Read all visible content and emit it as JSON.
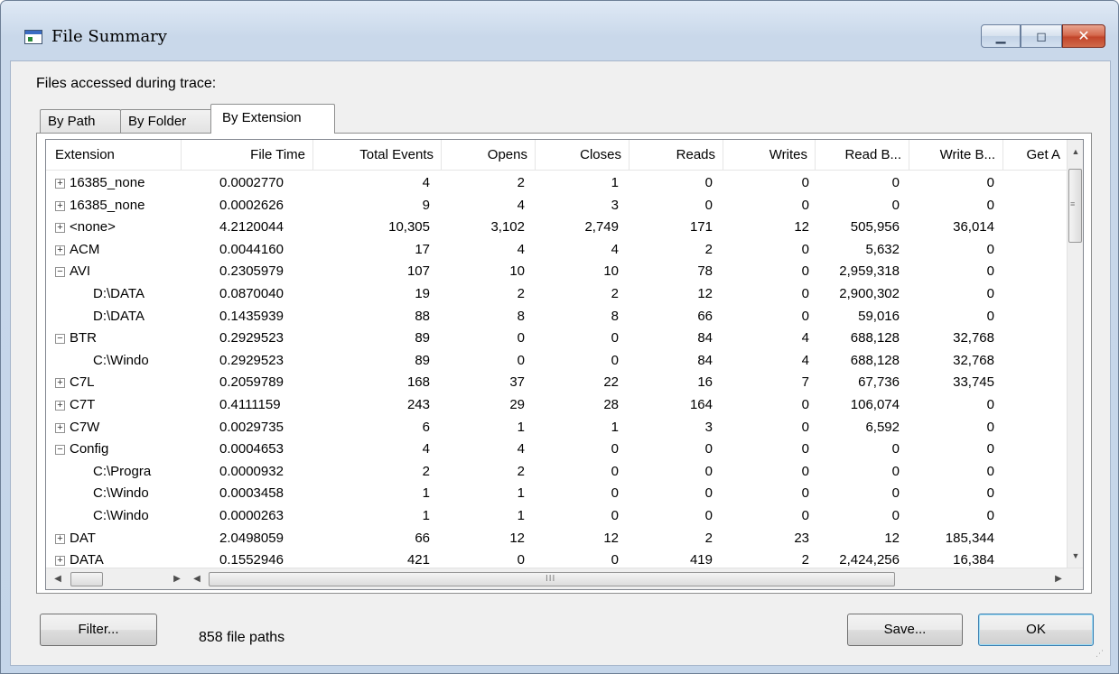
{
  "window": {
    "title": "File Summary",
    "caption_buttons": [
      {
        "name": "minimize",
        "glyph": "▁"
      },
      {
        "name": "maximize",
        "glyph": "◻"
      },
      {
        "name": "close",
        "glyph": "✕"
      }
    ]
  },
  "label_accessed": "Files accessed during trace:",
  "tabs": [
    {
      "label": "By Path",
      "active": false
    },
    {
      "label": "By Folder",
      "active": false
    },
    {
      "label": "By Extension",
      "active": true
    }
  ],
  "columns": [
    {
      "label": "Extension"
    },
    {
      "label": "File Time"
    },
    {
      "label": "Total Events"
    },
    {
      "label": "Opens"
    },
    {
      "label": "Closes"
    },
    {
      "label": "Reads"
    },
    {
      "label": "Writes"
    },
    {
      "label": "Read B..."
    },
    {
      "label": "Write B..."
    },
    {
      "label": "Get A"
    }
  ],
  "rows": [
    {
      "name": "16385_none",
      "expander": "+",
      "cells": [
        "0.0002770",
        "4",
        "2",
        "1",
        "0",
        "0",
        "0",
        "0"
      ]
    },
    {
      "name": "16385_none",
      "expander": "+",
      "cells": [
        "0.0002626",
        "9",
        "4",
        "3",
        "0",
        "0",
        "0",
        "0"
      ]
    },
    {
      "name": "<none>",
      "expander": "+",
      "cells": [
        "4.2120044",
        "10,305",
        "3,102",
        "2,749",
        "171",
        "12",
        "505,956",
        "36,014"
      ]
    },
    {
      "name": "ACM",
      "expander": "+",
      "cells": [
        "0.0044160",
        "17",
        "4",
        "4",
        "2",
        "0",
        "5,632",
        "0"
      ]
    },
    {
      "name": "AVI",
      "expander": "-",
      "cells": [
        "0.2305979",
        "107",
        "10",
        "10",
        "78",
        "0",
        "2,959,318",
        "0"
      ]
    },
    {
      "name": "D:\\DATA",
      "expander": "",
      "cells": [
        "0.0870040",
        "19",
        "2",
        "2",
        "12",
        "0",
        "2,900,302",
        "0"
      ]
    },
    {
      "name": "D:\\DATA",
      "expander": "",
      "cells": [
        "0.1435939",
        "88",
        "8",
        "8",
        "66",
        "0",
        "59,016",
        "0"
      ]
    },
    {
      "name": "BTR",
      "expander": "-",
      "cells": [
        "0.2929523",
        "89",
        "0",
        "0",
        "84",
        "4",
        "688,128",
        "32,768"
      ]
    },
    {
      "name": "C:\\Windo",
      "expander": "",
      "cells": [
        "0.2929523",
        "89",
        "0",
        "0",
        "84",
        "4",
        "688,128",
        "32,768"
      ]
    },
    {
      "name": "C7L",
      "expander": "+",
      "cells": [
        "0.2059789",
        "168",
        "37",
        "22",
        "16",
        "7",
        "67,736",
        "33,745"
      ]
    },
    {
      "name": "C7T",
      "expander": "+",
      "cells": [
        "0.4111159",
        "243",
        "29",
        "28",
        "164",
        "0",
        "106,074",
        "0"
      ]
    },
    {
      "name": "C7W",
      "expander": "+",
      "cells": [
        "0.0029735",
        "6",
        "1",
        "1",
        "3",
        "0",
        "6,592",
        "0"
      ]
    },
    {
      "name": "Config",
      "expander": "-",
      "cells": [
        "0.0004653",
        "4",
        "4",
        "0",
        "0",
        "0",
        "0",
        "0"
      ]
    },
    {
      "name": "C:\\Progra",
      "expander": "",
      "cells": [
        "0.0000932",
        "2",
        "2",
        "0",
        "0",
        "0",
        "0",
        "0"
      ]
    },
    {
      "name": "C:\\Windo",
      "expander": "",
      "cells": [
        "0.0003458",
        "1",
        "1",
        "0",
        "0",
        "0",
        "0",
        "0"
      ]
    },
    {
      "name": "C:\\Windo",
      "expander": "",
      "cells": [
        "0.0000263",
        "1",
        "1",
        "0",
        "0",
        "0",
        "0",
        "0"
      ]
    },
    {
      "name": "DAT",
      "expander": "+",
      "cells": [
        "2.0498059",
        "66",
        "12",
        "12",
        "2",
        "23",
        "12",
        "185,344"
      ]
    },
    {
      "name": "DATA",
      "expander": "+",
      "cells": [
        "0.1552946",
        "421",
        "0",
        "0",
        "419",
        "2",
        "2,424,256",
        "16,384"
      ]
    }
  ],
  "buttons": {
    "filter": "Filter...",
    "save": "Save...",
    "ok": "OK"
  },
  "status": "858 file paths"
}
